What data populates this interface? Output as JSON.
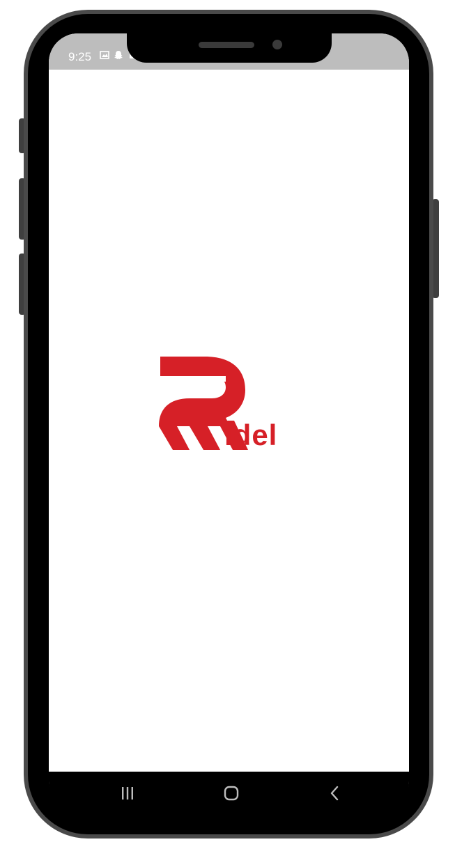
{
  "status_bar": {
    "time": "9:25",
    "icons": [
      "image-icon",
      "snapchat-icon",
      "notification-icon"
    ]
  },
  "splash": {
    "brand_initial": "R",
    "brand_suffix": "idel",
    "brand_color": "#d62027",
    "background_color": "#ffffff"
  },
  "nav_bar": {
    "buttons": [
      "recent-apps-icon",
      "home-icon",
      "back-icon"
    ]
  }
}
